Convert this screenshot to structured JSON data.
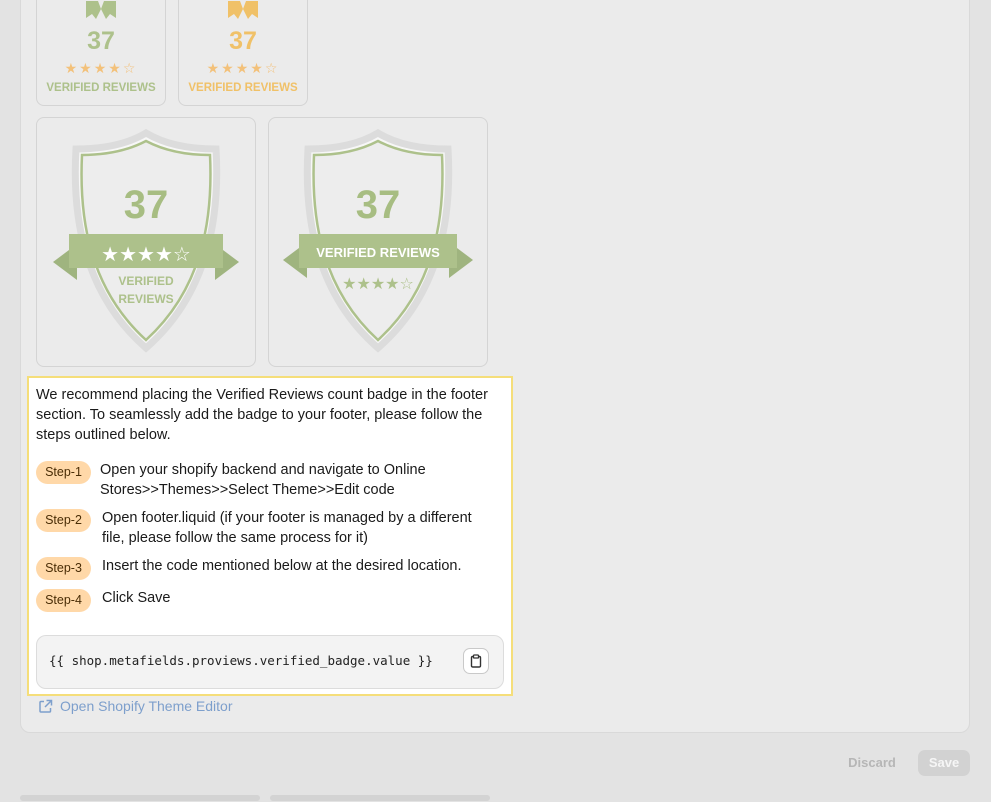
{
  "colors": {
    "green_badge": "#adc18b",
    "gold_badge": "#f0c168",
    "step_pill": "#ffd8a8",
    "highlight_border": "#f5de7a",
    "link": "#7d9fcc"
  },
  "badges": {
    "small": [
      {
        "count": "37",
        "stars": "★★★★☆",
        "label": "VERIFIED REVIEWS",
        "color": "#adc18b"
      },
      {
        "count": "37",
        "stars": "★★★★☆",
        "label": "VERIFIED REVIEWS",
        "color": "#f0c168"
      }
    ],
    "shield_1": {
      "count": "37",
      "stars": "★★★★☆",
      "label_line1": "VERIFIED",
      "label_line2": "REVIEWS"
    },
    "shield_2": {
      "count": "37",
      "banner": "VERIFIED REVIEWS",
      "stars": "★★★★☆"
    }
  },
  "instructions": {
    "intro": "We recommend placing the Verified Reviews count badge in the footer section. To seamlessly add the badge to your footer, please follow the steps outlined below.",
    "steps": [
      {
        "label": "Step-1",
        "text": "Open your shopify backend and navigate to Online Stores>>Themes>>Select Theme>>Edit code"
      },
      {
        "label": "Step-2",
        "text": "Open footer.liquid (if your footer is managed by a different file, please follow the same process for it)"
      },
      {
        "label": "Step-3",
        "text": "Insert the code mentioned below at the desired location."
      },
      {
        "label": "Step-4",
        "text": "Click Save"
      }
    ],
    "code": "{{ shop.metafields.proviews.verified_badge.value }}",
    "copy_icon": "clipboard-icon"
  },
  "link": {
    "label": "Open Shopify Theme Editor",
    "icon": "external-link-icon"
  },
  "actions": {
    "discard": "Discard",
    "save": "Save"
  }
}
